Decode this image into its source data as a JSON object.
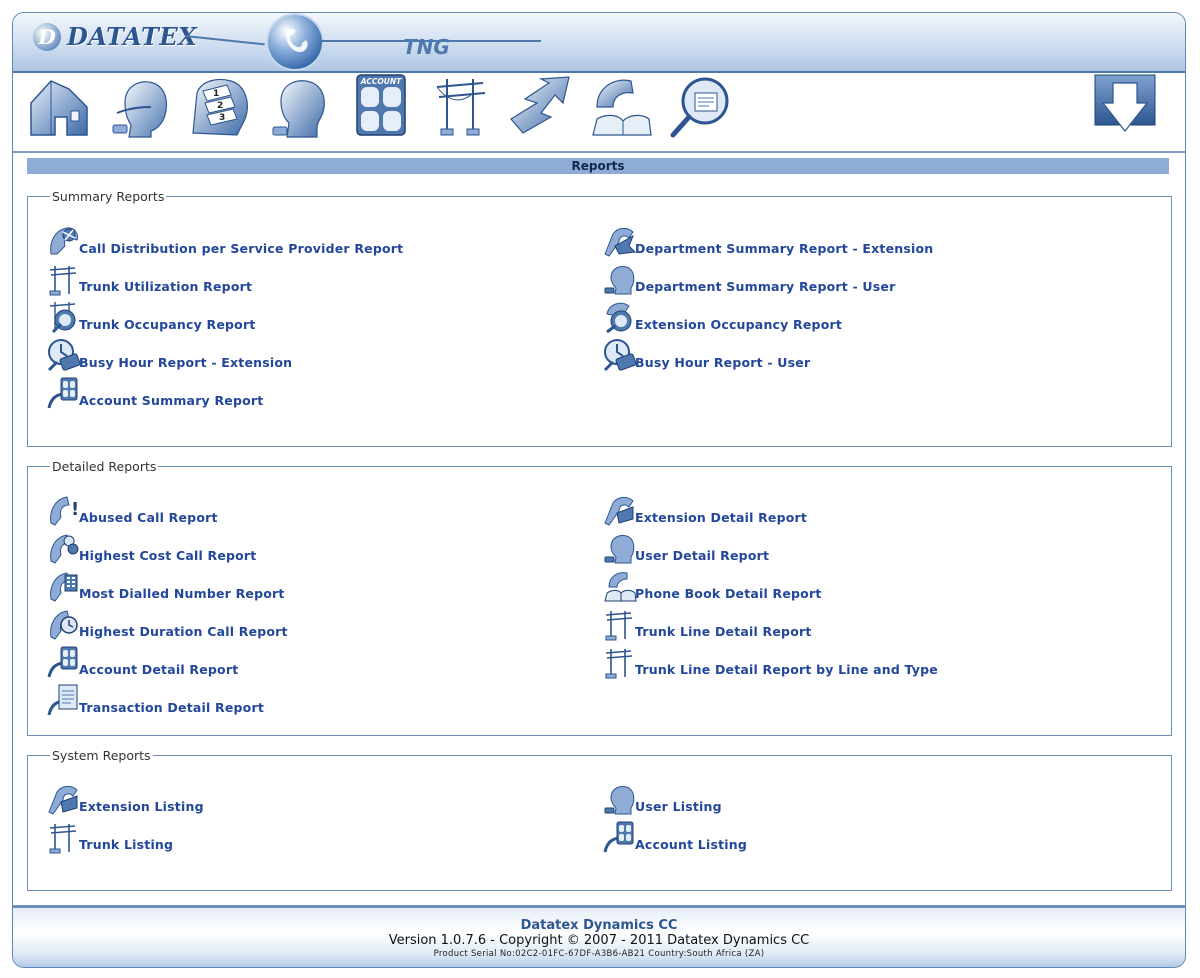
{
  "brand": {
    "logo_letter": "D",
    "name": "DATATEX",
    "product": "TNG"
  },
  "toolbar": {
    "items": [
      {
        "icon": "home-icon"
      },
      {
        "icon": "headset-operator-icon"
      },
      {
        "icon": "numbered-extensions-icon"
      },
      {
        "icon": "user-head-icon"
      },
      {
        "icon": "account-icon",
        "label": "ACCOUNT"
      },
      {
        "icon": "trunk-lines-icon"
      },
      {
        "icon": "department-tree-icon"
      },
      {
        "icon": "phone-book-icon"
      },
      {
        "icon": "reports-magnifier-icon"
      }
    ],
    "logout_icon": "logout-icon"
  },
  "page": {
    "title": "Reports"
  },
  "sections": {
    "summary": {
      "legend": "Summary Reports",
      "left": [
        {
          "label": "Call Distribution per Service Provider Report",
          "icon": "service-provider-icon"
        },
        {
          "label": "Trunk Utilization Report",
          "icon": "trunk-icon"
        },
        {
          "label": "Trunk Occupancy Report",
          "icon": "trunk-occupancy-icon"
        },
        {
          "label": "Busy Hour Report - Extension",
          "icon": "busy-hour-icon"
        },
        {
          "label": "Account Summary Report",
          "icon": "account-icon"
        }
      ],
      "right": [
        {
          "label": "Department Summary Report - Extension",
          "icon": "department-extension-icon"
        },
        {
          "label": "Department Summary Report - User",
          "icon": "department-user-icon"
        },
        {
          "label": "Extension Occupancy Report",
          "icon": "extension-occupancy-icon"
        },
        {
          "label": "Busy Hour Report - User",
          "icon": "busy-hour-icon"
        }
      ]
    },
    "detailed": {
      "legend": "Detailed Reports",
      "left": [
        {
          "label": "Abused Call Report",
          "icon": "abused-call-icon"
        },
        {
          "label": "Highest Cost Call Report",
          "icon": "highest-cost-icon"
        },
        {
          "label": "Most Dialled Number Report",
          "icon": "most-dialled-icon"
        },
        {
          "label": "Highest Duration Call Report",
          "icon": "duration-clock-icon"
        },
        {
          "label": "Account Detail Report",
          "icon": "account-icon"
        },
        {
          "label": "Transaction Detail Report",
          "icon": "transaction-document-icon"
        }
      ],
      "right": [
        {
          "label": "Extension Detail Report",
          "icon": "extension-icon"
        },
        {
          "label": "User Detail Report",
          "icon": "user-head-icon"
        },
        {
          "label": "Phone Book Detail Report",
          "icon": "phone-book-icon"
        },
        {
          "label": "Trunk Line Detail Report",
          "icon": "trunk-icon"
        },
        {
          "label": "Trunk Line Detail Report by Line and Type",
          "icon": "trunk-icon"
        }
      ]
    },
    "system": {
      "legend": "System Reports",
      "left": [
        {
          "label": "Extension Listing",
          "icon": "extension-icon"
        },
        {
          "label": "Trunk Listing",
          "icon": "trunk-icon"
        }
      ],
      "right": [
        {
          "label": "User Listing",
          "icon": "user-head-icon"
        },
        {
          "label": "Account Listing",
          "icon": "account-icon"
        }
      ]
    }
  },
  "footer": {
    "company": "Datatex Dynamics CC",
    "version": "Version 1.0.7.6 - Copyright © 2007 - 2011 Datatex Dynamics CC",
    "serial": "Product Serial No:02C2-01FC-67DF-A3B6-AB21 Country:South Africa (ZA)"
  },
  "colors": {
    "accent": "#4f79ae",
    "link": "#23479b",
    "bar": "#8eacd6",
    "border": "#6b8bb8"
  }
}
